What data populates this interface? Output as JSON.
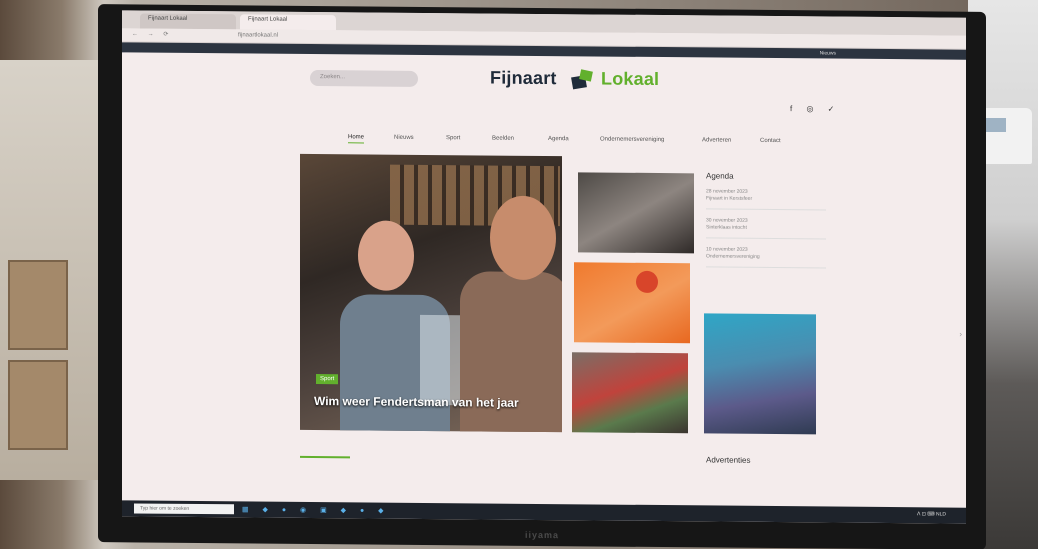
{
  "site": {
    "search_placeholder": "Zoeken...",
    "logo_part1": "Fijnaart",
    "logo_part2": "Lokaal",
    "social_icons": [
      "facebook-icon",
      "instagram-icon",
      "twitter-icon"
    ],
    "social_glyphs": "f ◎ ✓"
  },
  "nav": [
    "Home",
    "Nieuws",
    "Sport",
    "Beelden",
    "Agenda",
    "Ondernemersvereniging",
    "Adverteren",
    "Contact"
  ],
  "hero": {
    "badge": "Sport",
    "title": "Wim weer Fendertsman van het jaar"
  },
  "agenda": {
    "title": "Agenda",
    "items": [
      {
        "date": "28 november 2023",
        "text": "Fijnaart in Kerstsfeer"
      },
      {
        "date": "30 november 2023",
        "text": "Sinterklaas intocht"
      },
      {
        "date": "10 november 2023",
        "text": "Ondernemersvereniging"
      }
    ]
  },
  "advert_label": "Advertenties",
  "taskbar": {
    "search_placeholder": "Typ hier om te zoeken",
    "icons": "▦ ◆ ● ◉ ▣ ◆ ● ◆",
    "right": "ᐱ ⊡ ⌨ NLD"
  },
  "monitor_brand": "iiyama",
  "chrome": {
    "tab1": "Fijnaart Lokaal",
    "tab2": "Fijnaart Lokaal",
    "url": "fijnaartlokaal.nl",
    "nav_glyphs": "← → ⟳"
  },
  "banner_right": "Nieuws",
  "scroll_glyph": "›",
  "colors": {
    "brand_green": "#62b02d",
    "brand_navy": "#1f2b3a"
  }
}
